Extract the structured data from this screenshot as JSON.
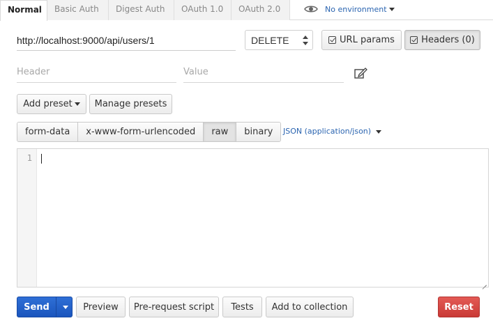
{
  "auth_tabs": [
    {
      "label": "Normal",
      "active": true
    },
    {
      "label": "Basic Auth",
      "active": false
    },
    {
      "label": "Digest Auth",
      "active": false
    },
    {
      "label": "OAuth 1.0",
      "active": false
    },
    {
      "label": "OAuth 2.0",
      "active": false
    }
  ],
  "environment": {
    "label": "No environment",
    "icon": "eye-icon"
  },
  "request": {
    "url": "http://localhost:9000/api/users/1",
    "method": "DELETE",
    "url_params_label": "URL params",
    "headers_label": "Headers (0)"
  },
  "headers_editor": {
    "key_placeholder": "Header",
    "value_placeholder": "Value",
    "bulk_edit_icon": "edit-icon"
  },
  "presets": {
    "add_label": "Add preset",
    "manage_label": "Manage presets"
  },
  "body": {
    "modes": [
      "form-data",
      "x-www-form-urlencoded",
      "raw",
      "binary"
    ],
    "active_mode": "raw",
    "content_type": "JSON (application/json)",
    "editor": {
      "line_numbers": [
        "1"
      ],
      "text": ""
    }
  },
  "actions": {
    "send": "Send",
    "preview": "Preview",
    "pre_request": "Pre-request script",
    "tests": "Tests",
    "add_to_collection": "Add to collection",
    "reset": "Reset"
  },
  "colors": {
    "primary": "#1f5fc8",
    "danger": "#d9534f",
    "link": "#2a64b0"
  }
}
